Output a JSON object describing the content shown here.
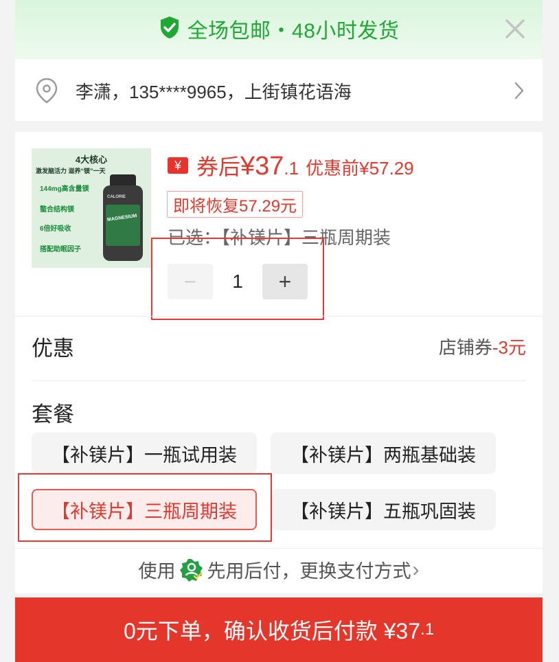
{
  "banner": {
    "text": "全场包邮・48小时发货",
    "icon": "shield-check-icon",
    "close_icon": "close-icon"
  },
  "address": {
    "text": "李潇，135****9965，上街镇花语海",
    "icon": "location-pin-icon"
  },
  "product": {
    "image_lines": {
      "title": "4大核心",
      "subtitle": "激发脑活力 滋养“镁”一天",
      "f1": "144mg高含量镁",
      "f2": "螯合结构镁",
      "f3": "6倍好吸收",
      "f4": "搭配助眠因子",
      "bottle_label": "MAGNESIUM",
      "brand": "CALORIE"
    },
    "coupon_icon": "¥",
    "after_label": "券后",
    "after_price_int": "¥37",
    "after_price_dec": ".1",
    "before_price": "优惠前¥57.29",
    "restore_tag": "即将恢复57.29元",
    "selected_label": "已选：",
    "selected_value": "【补镁片】三瓶周期装",
    "minus": "−",
    "quantity": "1",
    "plus": "+"
  },
  "discount": {
    "label": "优惠",
    "value_prefix": "店铺券",
    "value_amount": "-3元"
  },
  "packages": {
    "title": "套餐",
    "items": [
      "【补镁片】一瓶试用装",
      "【补镁片】两瓶基础装",
      "【补镁片】三瓶周期装",
      "【补镁片】五瓶巩固装"
    ],
    "selected_index": 2
  },
  "paylater": {
    "prefix": "使用",
    "text": "先用后付，更换支付方式",
    "chevron": "›"
  },
  "cta": {
    "text": "0元下单，确认收货后付款 ¥37",
    "dec": ".1"
  },
  "colors": {
    "accent_red": "#e4362a",
    "banner_green": "#1fa833"
  }
}
